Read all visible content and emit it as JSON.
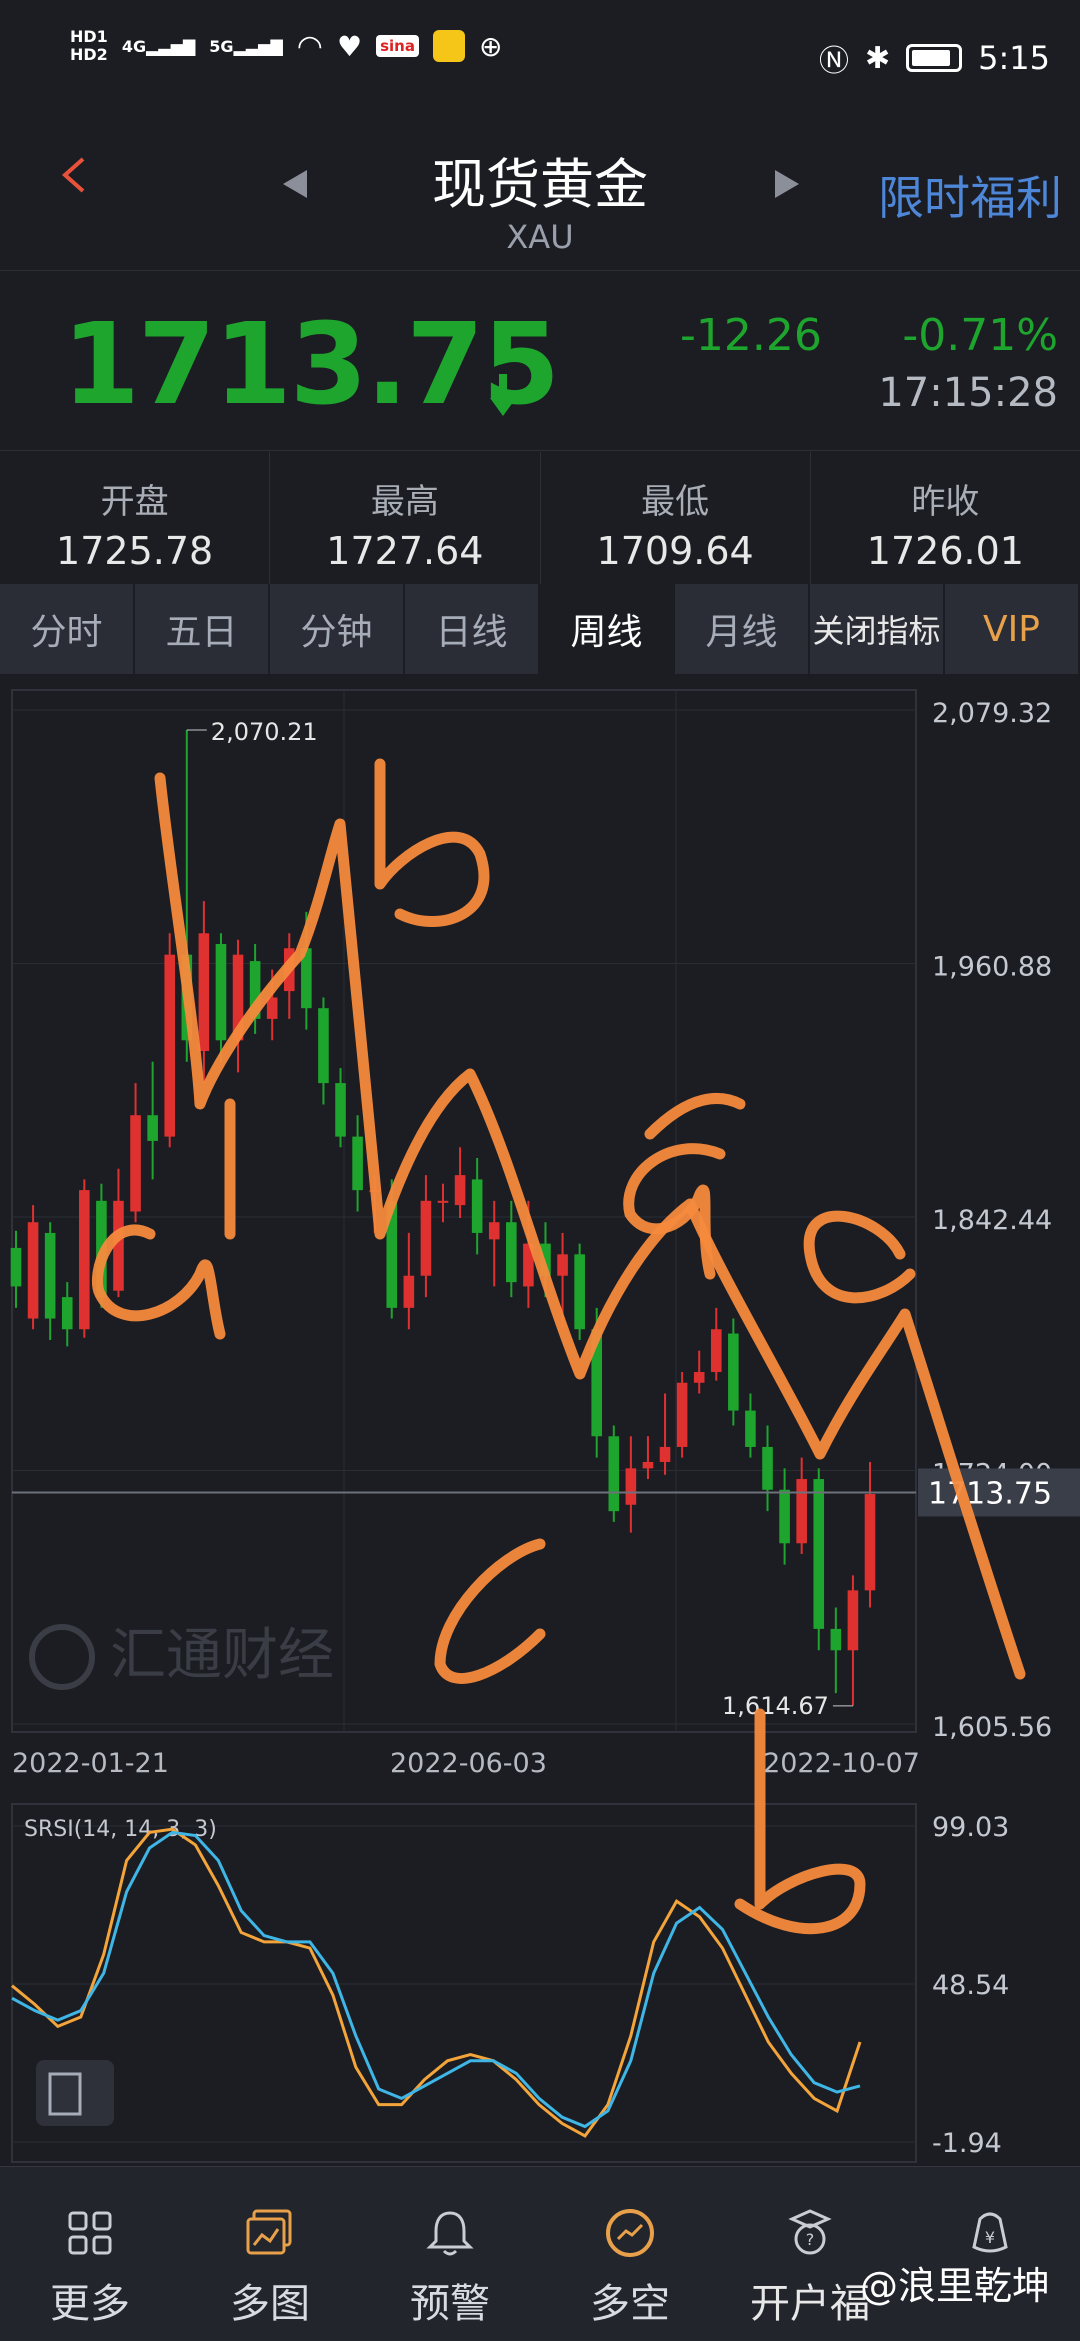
{
  "status_bar": {
    "left_icons": [
      "hd-1-icon",
      "4g-signal-icon",
      "5g-signal-icon",
      "wifi-icon",
      "heart-icon",
      "sina-icon",
      "weibo-icon",
      "ball-icon"
    ],
    "hd1": "HD1",
    "hd2": "HD2",
    "net1": "4G",
    "net2": "5G",
    "sina": "sina",
    "time": "5:15",
    "battery_level": 0.85
  },
  "header": {
    "title": "现货黄金",
    "symbol": "XAU",
    "promo": "限时福利"
  },
  "quote": {
    "price": "1713.75",
    "change": "-12.26",
    "change_pct": "-0.71%",
    "time": "17:15:28"
  },
  "stats": [
    {
      "label": "开盘",
      "value": "1725.78"
    },
    {
      "label": "最高",
      "value": "1727.64"
    },
    {
      "label": "最低",
      "value": "1709.64"
    },
    {
      "label": "昨收",
      "value": "1726.01"
    }
  ],
  "tabs": [
    {
      "label": "分时",
      "active": false
    },
    {
      "label": "五日",
      "active": false
    },
    {
      "label": "分钟",
      "active": false
    },
    {
      "label": "日线",
      "active": false
    },
    {
      "label": "周线",
      "active": true
    },
    {
      "label": "月线",
      "active": false
    },
    {
      "label": "关闭指标",
      "active": false
    },
    {
      "label": "VIP",
      "active": false
    }
  ],
  "chart_data": [
    {
      "type": "candlestick",
      "y_ticks": [
        "2,079.32",
        "1,960.88",
        "1,842.44",
        "1,724.00",
        "1,605.56"
      ],
      "x_ticks": [
        "2022-01-21",
        "2022-06-03",
        "2022-10-07"
      ],
      "high_label": "2,070.21",
      "low_label": "1,614.67",
      "current_price_label": "1713.75",
      "ylim": [
        1605.56,
        2079.32
      ],
      "watermark": "汇通财经",
      "candles": [
        [
          1828,
          1810,
          1836,
          1800
        ],
        [
          1795,
          1840,
          1848,
          1790
        ],
        [
          1835,
          1795,
          1840,
          1785
        ],
        [
          1805,
          1790,
          1812,
          1782
        ],
        [
          1790,
          1855,
          1860,
          1786
        ],
        [
          1850,
          1805,
          1858,
          1800
        ],
        [
          1808,
          1850,
          1865,
          1805
        ],
        [
          1845,
          1890,
          1905,
          1840
        ],
        [
          1890,
          1878,
          1915,
          1860
        ],
        [
          1880,
          1965,
          1975,
          1875
        ],
        [
          1965,
          1925,
          2070,
          1915
        ],
        [
          1920,
          1975,
          1990,
          1905
        ],
        [
          1970,
          1925,
          1975,
          1915
        ],
        [
          1925,
          1965,
          1972,
          1910
        ],
        [
          1962,
          1935,
          1970,
          1928
        ],
        [
          1935,
          1945,
          1958,
          1925
        ],
        [
          1948,
          1968,
          1975,
          1935
        ],
        [
          1968,
          1940,
          1985,
          1930
        ],
        [
          1940,
          1905,
          1945,
          1895
        ],
        [
          1905,
          1880,
          1912,
          1875
        ],
        [
          1880,
          1855,
          1890,
          1845
        ],
        [
          1855,
          1855,
          1862,
          1835
        ],
        [
          1850,
          1800,
          1860,
          1795
        ],
        [
          1800,
          1815,
          1835,
          1790
        ],
        [
          1815,
          1850,
          1862,
          1805
        ],
        [
          1850,
          1850,
          1858,
          1840
        ],
        [
          1848,
          1862,
          1875,
          1842
        ],
        [
          1860,
          1835,
          1870,
          1825
        ],
        [
          1832,
          1840,
          1850,
          1810
        ],
        [
          1840,
          1812,
          1850,
          1805
        ],
        [
          1810,
          1830,
          1850,
          1800
        ],
        [
          1830,
          1815,
          1840,
          1805
        ],
        [
          1815,
          1825,
          1835,
          1790
        ],
        [
          1825,
          1790,
          1830,
          1785
        ],
        [
          1790,
          1740,
          1800,
          1730
        ],
        [
          1740,
          1705,
          1745,
          1700
        ],
        [
          1708,
          1725,
          1740,
          1695
        ],
        [
          1725,
          1728,
          1740,
          1720
        ],
        [
          1728,
          1735,
          1760,
          1722
        ],
        [
          1735,
          1765,
          1770,
          1730
        ],
        [
          1765,
          1770,
          1780,
          1760
        ],
        [
          1770,
          1790,
          1800,
          1766
        ],
        [
          1788,
          1752,
          1795,
          1745
        ],
        [
          1752,
          1735,
          1760,
          1730
        ],
        [
          1735,
          1715,
          1745,
          1705
        ],
        [
          1715,
          1690,
          1725,
          1680
        ],
        [
          1690,
          1720,
          1730,
          1685
        ],
        [
          1720,
          1650,
          1725,
          1640
        ],
        [
          1650,
          1640,
          1660,
          1620
        ],
        [
          1640,
          1668,
          1675,
          1614
        ],
        [
          1668,
          1713,
          1728,
          1660
        ]
      ]
    },
    {
      "type": "line",
      "title": "SRSI(14, 14, 3, 3)",
      "y_ticks": [
        "99.03",
        "48.54",
        "-1.94"
      ],
      "ylim": [
        -1.94,
        99.03
      ],
      "series": [
        {
          "color": "#f3a43a",
          "values": [
            48,
            42,
            35,
            38,
            58,
            88,
            97,
            98,
            93,
            80,
            65,
            62,
            62,
            60,
            45,
            22,
            10,
            10,
            18,
            24,
            26,
            24,
            18,
            10,
            4,
            0,
            10,
            32,
            62,
            75,
            70,
            60,
            45,
            30,
            20,
            12,
            8,
            30
          ]
        },
        {
          "color": "#3fb6e6",
          "values": [
            44,
            40,
            37,
            40,
            52,
            78,
            92,
            97,
            96,
            88,
            72,
            64,
            62,
            62,
            52,
            32,
            15,
            12,
            16,
            20,
            24,
            24,
            20,
            12,
            6,
            3,
            8,
            24,
            52,
            68,
            73,
            66,
            52,
            38,
            26,
            17,
            14,
            16
          ]
        }
      ]
    }
  ],
  "bottom_nav": [
    {
      "label": "更多",
      "icon": "grid-icon"
    },
    {
      "label": "多图",
      "icon": "multi-chart-icon"
    },
    {
      "label": "预警",
      "icon": "bell-icon"
    },
    {
      "label": "多空",
      "icon": "long-short-icon"
    },
    {
      "label": "开户福",
      "icon": "account-gift-icon"
    },
    {
      "label": "",
      "icon": "wallet-icon"
    }
  ],
  "overlay": {
    "user_watermark": "@浪里乾坤"
  },
  "colors": {
    "up": "#e03131",
    "down": "#1ea52e",
    "annotation": "#f58a3d"
  }
}
